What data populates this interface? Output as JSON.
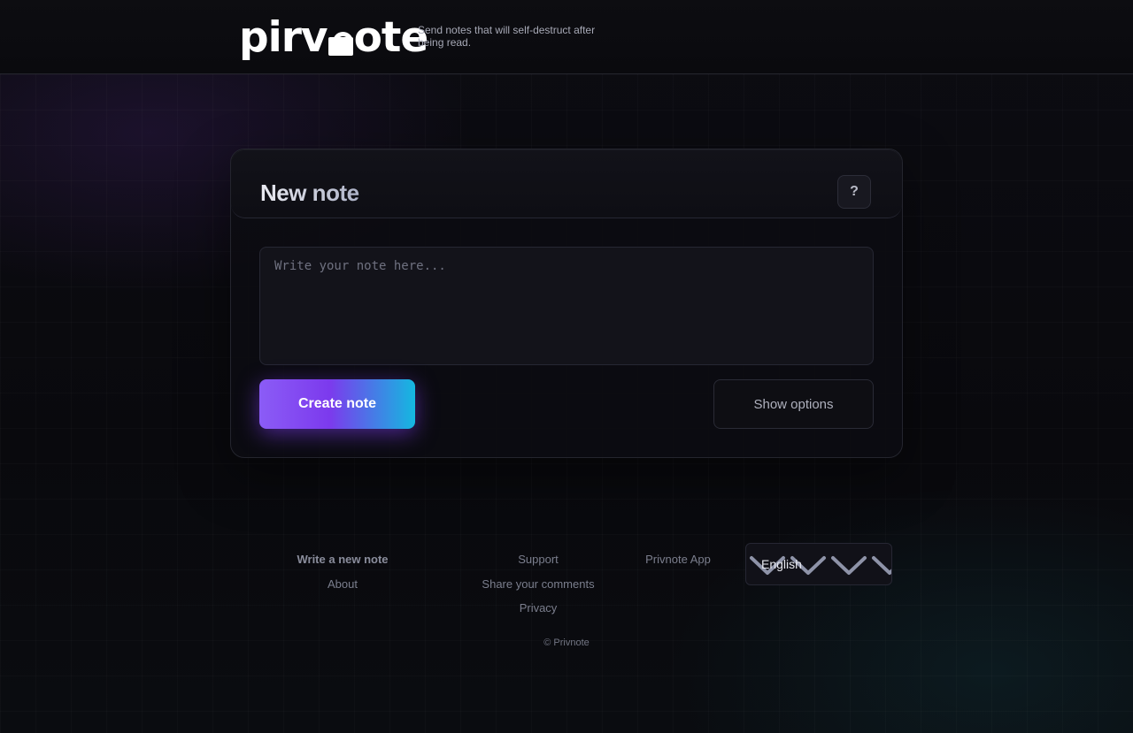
{
  "header": {
    "logo_left": "pirv",
    "logo_right": "ote",
    "tagline": "Send notes that will self-destruct after being read."
  },
  "card": {
    "title": "New note",
    "help_label": "?",
    "note_placeholder": "Write your note here...",
    "note_value": "",
    "create_label": "Create note",
    "options_label": "Show options"
  },
  "footer": {
    "links": {
      "write_new_note": "Write a new note",
      "about": "About",
      "support": "Support",
      "share_comments": "Share your comments",
      "privacy": "Privacy",
      "app": "Privnote App"
    },
    "language": "English",
    "copyright": "© Privnote"
  },
  "colors": {
    "background": "#09090d",
    "accent_start": "#8b5cf6",
    "accent_mid": "#7c3aed",
    "accent_end": "#14b8e0",
    "chevron": "#8e93a8"
  },
  "icons": {
    "logo_o": "lock-icon",
    "language_dropdown": "chevron-down-icon"
  }
}
